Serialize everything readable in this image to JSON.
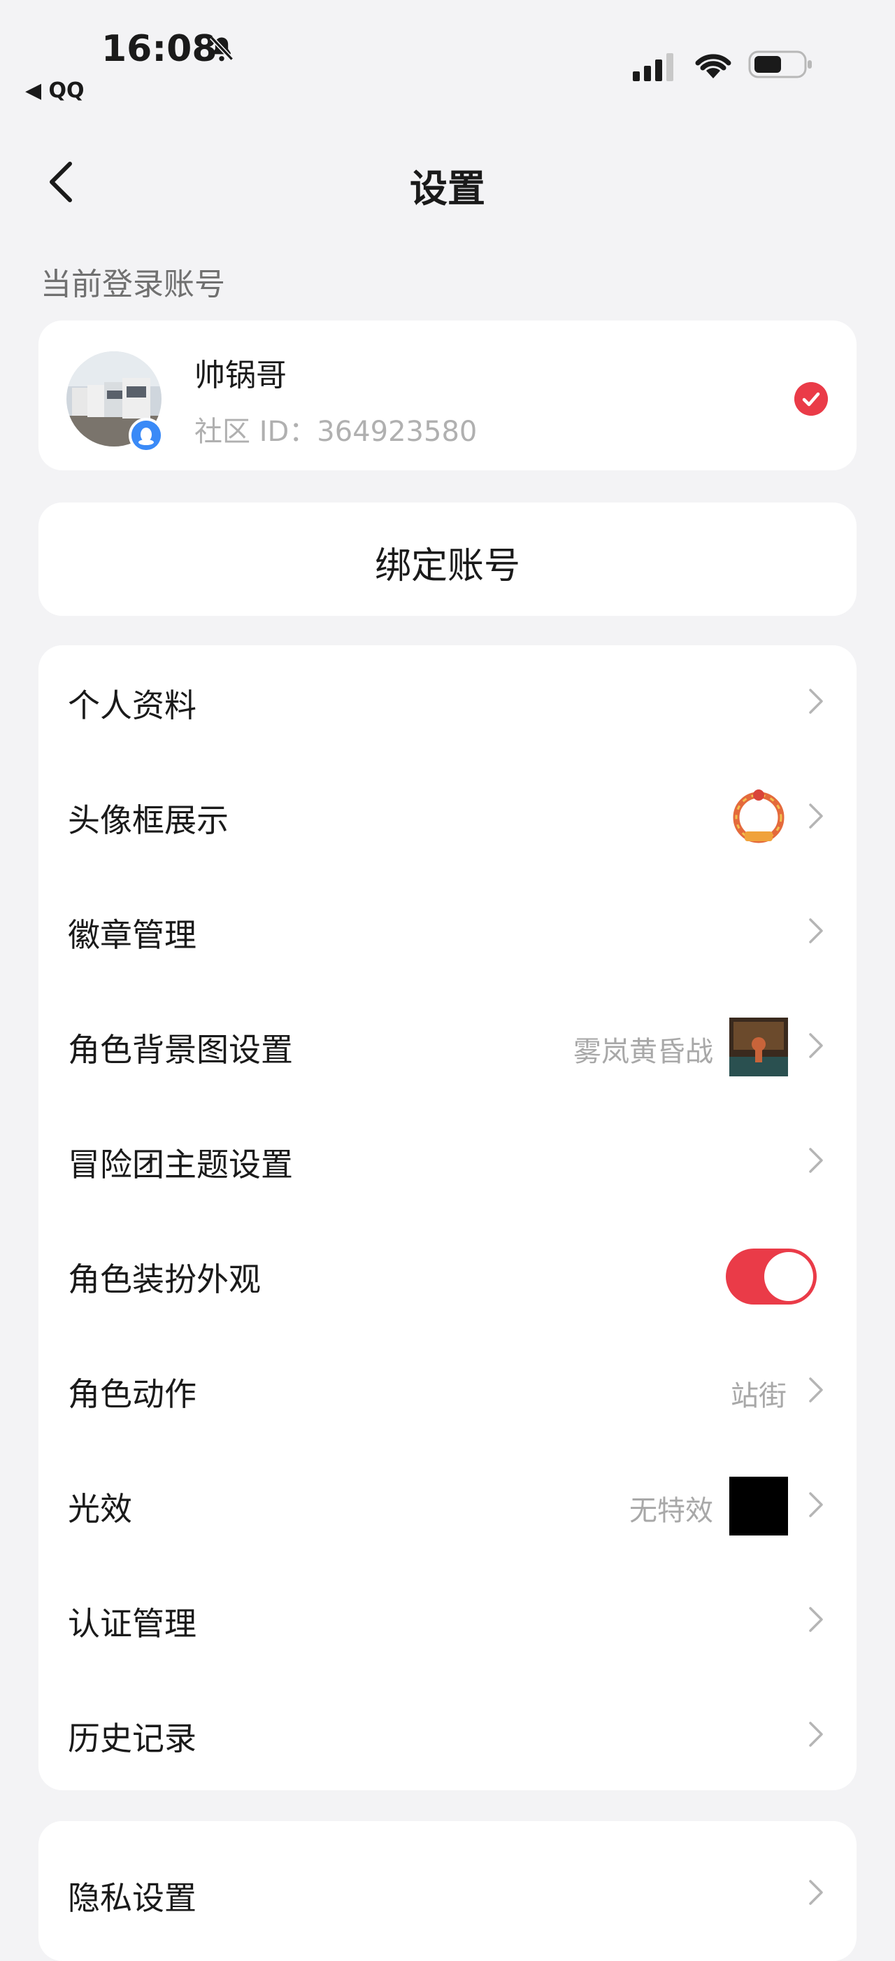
{
  "status_bar": {
    "time": "16:08",
    "back_app": "◀ QQ"
  },
  "nav": {
    "title": "设置"
  },
  "account_section_label": "当前登录账号",
  "account": {
    "name": "帅锅哥",
    "id_text": "社区 ID：364923580"
  },
  "bind_account_label": "绑定账号",
  "settings": [
    {
      "label": "个人资料",
      "value": ""
    },
    {
      "label": "头像框展示",
      "value": ""
    },
    {
      "label": "徽章管理",
      "value": ""
    },
    {
      "label": "角色背景图设置",
      "value": "雾岚黄昏战"
    },
    {
      "label": "冒险团主题设置",
      "value": ""
    },
    {
      "label": "角色装扮外观",
      "value": "",
      "toggle": "on"
    },
    {
      "label": "角色动作",
      "value": "站街"
    },
    {
      "label": "光效",
      "value": "无特效"
    },
    {
      "label": "认证管理",
      "value": ""
    },
    {
      "label": "历史记录",
      "value": ""
    }
  ],
  "privacy": {
    "label": "隐私设置"
  },
  "colors": {
    "accent": "#ea3b48",
    "background": "#f3f3f5",
    "card": "#ffffff",
    "secondary_text": "#a8a8a8"
  },
  "icons": [
    "bell-slash-icon",
    "signal-icon",
    "wifi-icon",
    "battery-icon",
    "back-arrow-icon",
    "check-icon",
    "chevron-right-icon"
  ]
}
